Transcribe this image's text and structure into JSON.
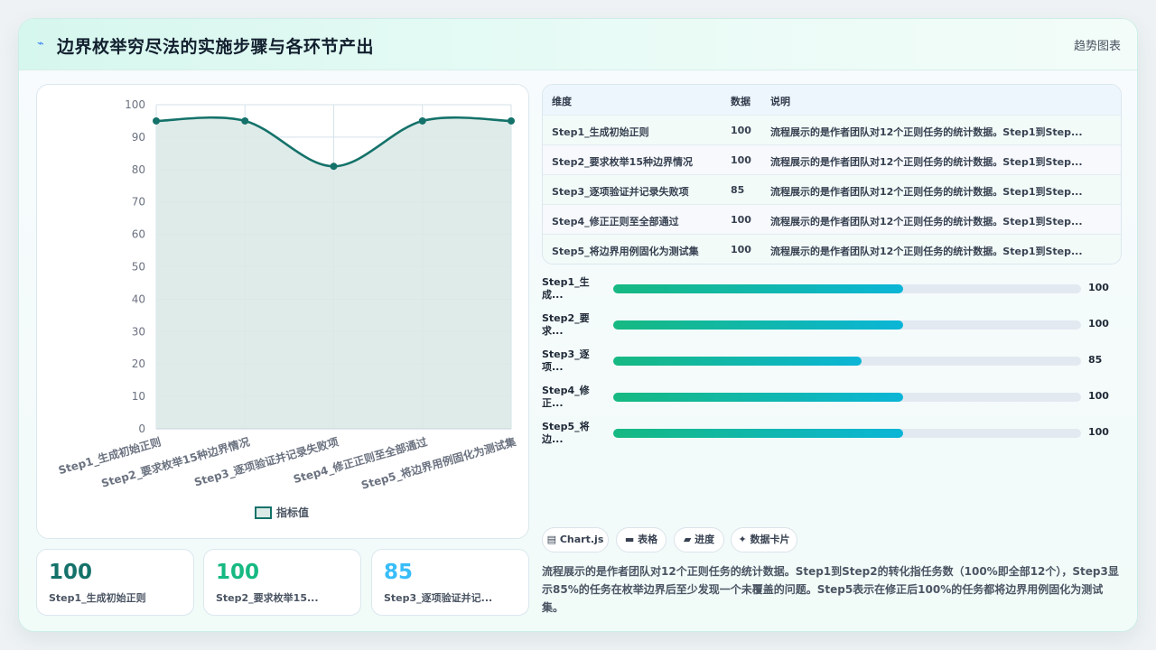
{
  "header": {
    "icon": "lightning-icon",
    "title": "边界枚举穷尽法的实施步骤与各环节产出",
    "link": "趋势图表"
  },
  "chart_data": {
    "type": "line",
    "categories": [
      "Step1_生成初始正则",
      "Step2_要求枚举15种边界情况",
      "Step3_逐项验证并记录失败项",
      "Step4_修正正则至全部通过",
      "Step5_将边界用例固化为测试集"
    ],
    "series": [
      {
        "name": "指标值",
        "values": [
          95,
          95,
          81,
          95,
          95
        ]
      }
    ],
    "ylim": [
      0,
      100
    ],
    "yticks": [
      0,
      10,
      20,
      30,
      40,
      50,
      60,
      70,
      80,
      90,
      100
    ],
    "grid": true,
    "fill": true,
    "legend": "bottom",
    "colors": {
      "line": "#14726a",
      "fill": "#dbe9e7"
    }
  },
  "table": {
    "headers": [
      "维度",
      "数据",
      "说明"
    ],
    "rows": [
      {
        "dim": "Step1_生成初始正则",
        "value": "100",
        "desc": "流程展示的是作者团队对12个正则任务的统计数据。Step1到Step..."
      },
      {
        "dim": "Step2_要求枚举15种边界情况",
        "value": "100",
        "desc": "流程展示的是作者团队对12个正则任务的统计数据。Step1到Step..."
      },
      {
        "dim": "Step3_逐项验证并记录失败项",
        "value": "85",
        "desc": "流程展示的是作者团队对12个正则任务的统计数据。Step1到Step..."
      },
      {
        "dim": "Step4_修正正则至全部通过",
        "value": "100",
        "desc": "流程展示的是作者团队对12个正则任务的统计数据。Step1到Step..."
      },
      {
        "dim": "Step5_将边界用例固化为测试集",
        "value": "100",
        "desc": "流程展示的是作者团队对12个正则任务的统计数据。Step1到Step..."
      }
    ]
  },
  "progress": [
    {
      "label": "Step1_生成...",
      "value": "100",
      "fill_percent": 62
    },
    {
      "label": "Step2_要求...",
      "value": "100",
      "fill_percent": 62
    },
    {
      "label": "Step3_逐项...",
      "value": "85",
      "fill_percent": 53
    },
    {
      "label": "Step4_修正...",
      "value": "100",
      "fill_percent": 62
    },
    {
      "label": "Step5_将边...",
      "value": "100",
      "fill_percent": 62
    }
  ],
  "kpis": [
    {
      "value": "100",
      "label": "Step1_生成初始正则",
      "color": "#14726a"
    },
    {
      "value": "100",
      "label": "Step2_要求枚举15...",
      "color": "#16b981"
    },
    {
      "value": "85",
      "label": "Step3_逐项验证并记...",
      "color": "#38bdf8"
    }
  ],
  "tags": [
    {
      "icon": "chart-icon",
      "label": "Chart.js"
    },
    {
      "icon": "table-icon",
      "label": "表格"
    },
    {
      "icon": "progress-icon",
      "label": "进度"
    },
    {
      "icon": "sparkle-icon",
      "label": "数据卡片"
    }
  ],
  "description": "流程展示的是作者团队对12个正则任务的统计数据。Step1到Step2的转化指任务数（100%即全部12个），Step3显示85%的任务在枚举边界后至少发现一个未覆盖的问题。Step5表示在修正后100%的任务都将边界用例固化为测试集。"
}
